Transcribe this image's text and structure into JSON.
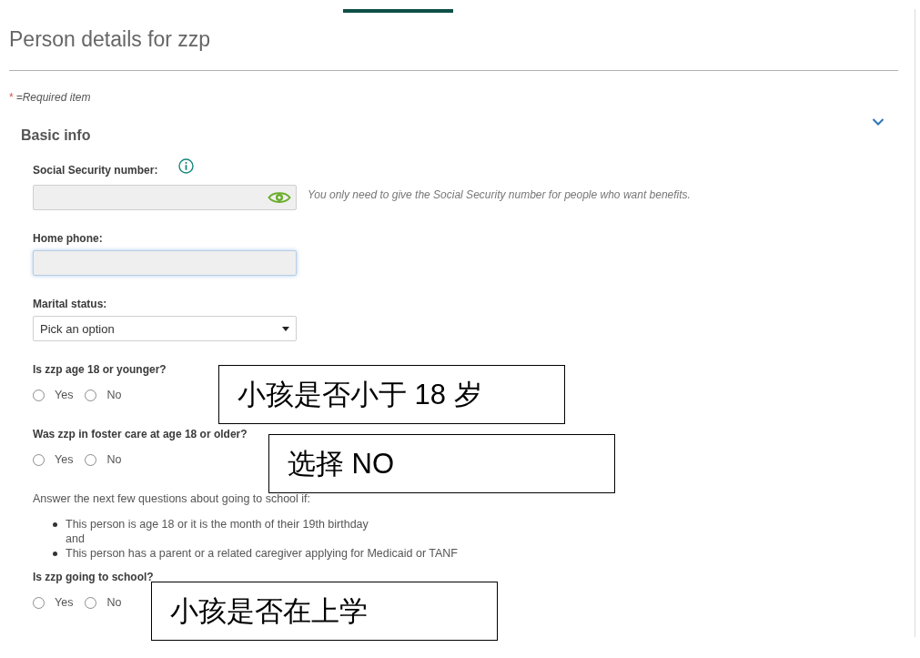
{
  "page": {
    "title": "Person details for zzp"
  },
  "required_note": {
    "mark": "*",
    "text": "=Required item"
  },
  "section": {
    "title": "Basic info",
    "expanded": true,
    "fields": [
      {
        "kind": "secure_text",
        "label": "Social Security number:",
        "focused": false,
        "help": "You only need to give the Social Security number for people who want benefits."
      },
      {
        "kind": "text",
        "label": "Home phone:",
        "focused": true
      },
      {
        "kind": "select",
        "label": "Marital status:",
        "value": "Pick an option"
      },
      {
        "kind": "radio",
        "label": "Is zzp age 18 or younger?",
        "options": [
          {
            "label": "Yes",
            "selected": false
          },
          {
            "label": "No",
            "selected": false
          }
        ]
      },
      {
        "kind": "radio",
        "label": "Was zzp in foster care at age 18 or older?",
        "options": [
          {
            "label": "Yes",
            "selected": false
          },
          {
            "label": "No",
            "selected": false
          }
        ]
      },
      {
        "kind": "note",
        "text": "Answer the next few questions about going to school if:",
        "bullets": [
          {
            "lines": [
              "This person is age 18 or it is the month of their 19th birthday",
              "and"
            ]
          },
          {
            "lines": [
              "This person has a parent or a related caregiver applying for Medicaid or TANF"
            ]
          }
        ]
      },
      {
        "kind": "radio",
        "label": "Is zzp going to school?",
        "options": [
          {
            "label": "Yes",
            "selected": false
          },
          {
            "label": "No",
            "selected": false
          }
        ]
      }
    ]
  },
  "annotations": [
    {
      "text": "小孩是否小于 18 岁"
    },
    {
      "text": "选择 NO"
    },
    {
      "text": "小孩是否在上学"
    }
  ]
}
